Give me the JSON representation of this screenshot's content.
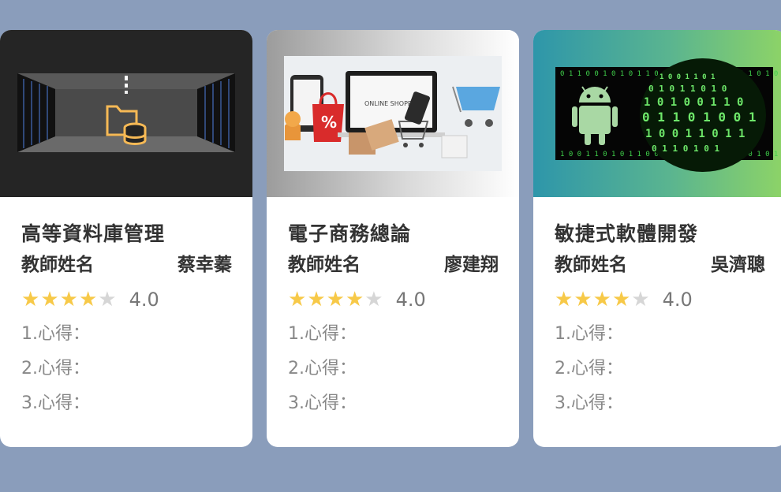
{
  "courses": [
    {
      "title": "高等資料庫管理",
      "teacher_label": "教師姓名",
      "teacher_name": "蔡幸蓁",
      "rating": "4.0",
      "stars": 4,
      "notes": [
        "1.心得：",
        "2.心得：",
        "3.心得："
      ],
      "image": "server-room-database-folder"
    },
    {
      "title": "電子商務總論",
      "teacher_label": "教師姓名",
      "teacher_name": "廖建翔",
      "rating": "4.0",
      "stars": 4,
      "notes": [
        "1.心得：",
        "2.心得：",
        "3.心得："
      ],
      "image": "online-shopping",
      "image_text": "ONLINE SHOPPI"
    },
    {
      "title": "敏捷式軟體開發",
      "teacher_label": "教師姓名",
      "teacher_name": "吳濟聰",
      "rating": "4.0",
      "stars": 4,
      "notes": [
        "1.心得：",
        "2.心得：",
        "3.心得："
      ],
      "image": "android-binary-code"
    }
  ],
  "colors": {
    "background": "#8a9dbb",
    "star_on": "#f7c948",
    "star_off": "#d6d6d6"
  }
}
